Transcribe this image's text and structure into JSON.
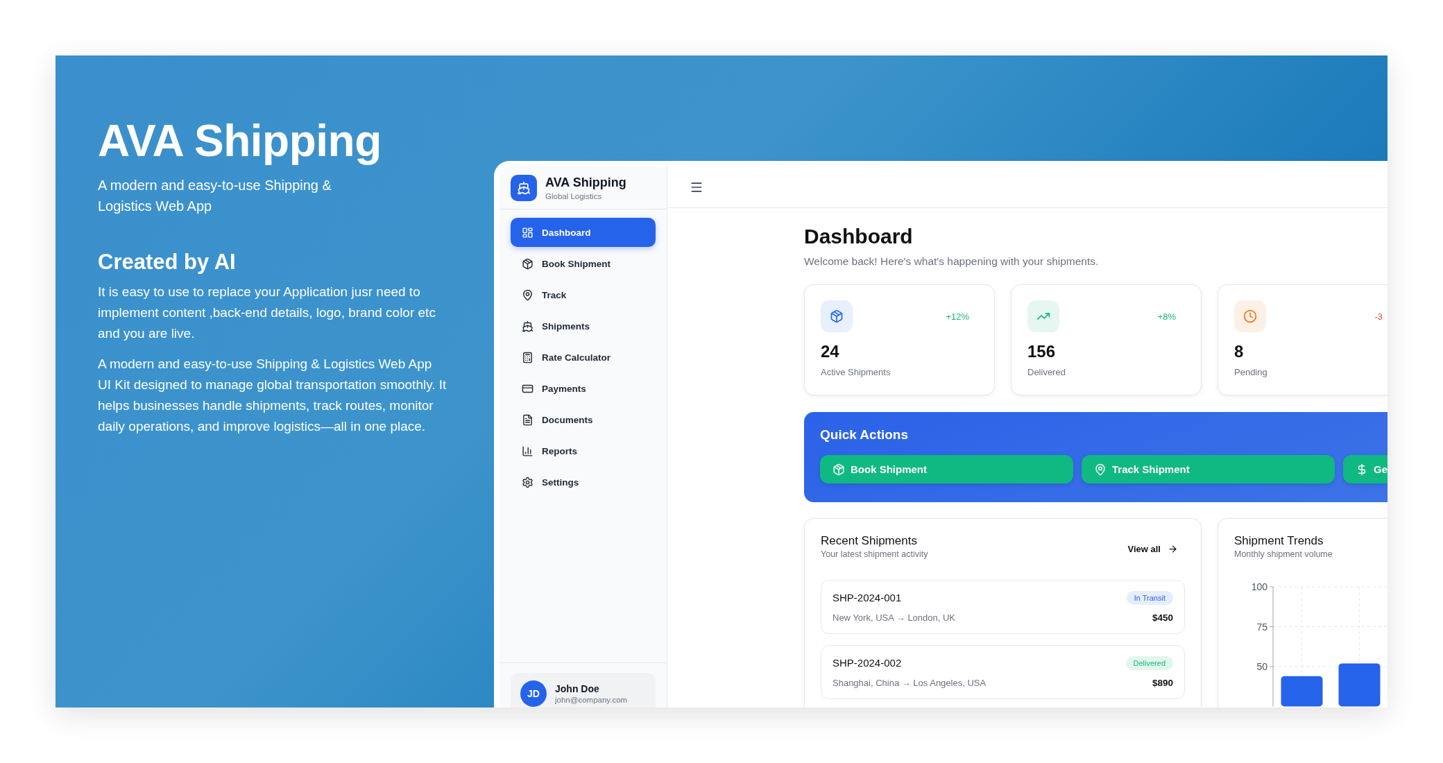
{
  "hero": {
    "title": "AVA Shipping",
    "subtitle": "A modern and easy-to-use Shipping & Logistics Web App",
    "section_title": "Created by AI",
    "paragraphs": [
      "It is easy to use to replace your Application jusr need to implement content ,back-end details, logo, brand color etc and you are live.",
      "A modern and easy-to-use Shipping & Logistics Web App UI Kit designed to manage global transportation smoothly. It helps businesses handle shipments, track routes, monitor daily operations, and improve logistics—all in one place."
    ]
  },
  "app": {
    "brand": {
      "name": "AVA Shipping",
      "tagline": "Global Logistics"
    },
    "nav": [
      {
        "label": "Dashboard",
        "selected": true
      },
      {
        "label": "Book Shipment",
        "selected": false
      },
      {
        "label": "Track",
        "selected": false
      },
      {
        "label": "Shipments",
        "selected": false
      },
      {
        "label": "Rate Calculator",
        "selected": false
      },
      {
        "label": "Payments",
        "selected": false
      },
      {
        "label": "Documents",
        "selected": false
      },
      {
        "label": "Reports",
        "selected": false
      },
      {
        "label": "Settings",
        "selected": false
      }
    ],
    "user": {
      "initials": "JD",
      "name": "John Doe",
      "email": "john@company.com"
    },
    "page": {
      "title": "Dashboard",
      "subtitle": "Welcome back! Here's what's happening with your shipments."
    },
    "stats": [
      {
        "value": "24",
        "label": "Active Shipments",
        "change": "+12%",
        "kind": "up"
      },
      {
        "value": "156",
        "label": "Delivered",
        "change": "+8%",
        "kind": "up"
      },
      {
        "value": "8",
        "label": "Pending",
        "change": "-3",
        "kind": "down"
      }
    ],
    "quick_actions": {
      "title": "Quick Actions",
      "buttons": [
        {
          "label": "Book Shipment"
        },
        {
          "label": "Track Shipment"
        },
        {
          "label": "Ge"
        }
      ]
    },
    "recent": {
      "title": "Recent Shipments",
      "subtitle": "Your latest shipment activity",
      "link": "View all",
      "items": [
        {
          "id": "SHP-2024-001",
          "route": "New York, USA → London, UK",
          "status": "In Transit",
          "kind": "transit",
          "price": "$450"
        },
        {
          "id": "SHP-2024-002",
          "route": "Shanghai, China → Los Angeles, USA",
          "status": "Delivered",
          "kind": "delivered",
          "price": "$890"
        }
      ]
    },
    "trends": {
      "title": "Shipment Trends",
      "subtitle": "Monthly shipment volume",
      "chart_data": {
        "type": "bar",
        "values": [
          44,
          52
        ],
        "ylim": [
          25,
          100
        ],
        "yticks": [
          50,
          75,
          100
        ],
        "grid": true
      }
    }
  }
}
